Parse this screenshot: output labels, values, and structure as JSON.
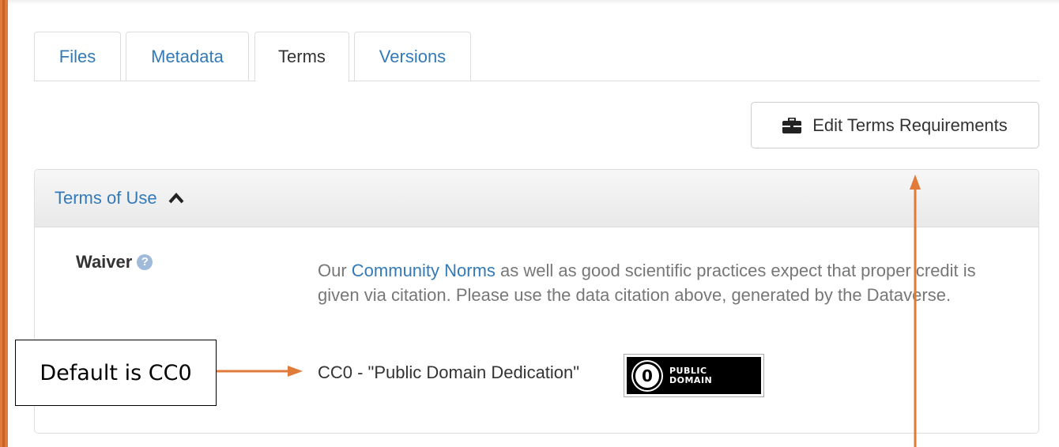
{
  "tabs": [
    {
      "label": "Files",
      "active": false
    },
    {
      "label": "Metadata",
      "active": false
    },
    {
      "label": "Terms",
      "active": true
    },
    {
      "label": "Versions",
      "active": false
    }
  ],
  "toolbar": {
    "edit_terms_label": "Edit Terms Requirements",
    "edit_terms_icon": "briefcase-icon"
  },
  "panel": {
    "heading": "Terms of Use",
    "heading_icon": "chevron-up-icon",
    "waiver_label": "Waiver",
    "help_icon_glyph": "?",
    "norms_prefix": "Our ",
    "norms_link": "Community Norms",
    "norms_suffix": " as well as good scientific practices expect that proper credit is given via citation. Please use the data citation above, generated by the Dataverse.",
    "license_text": "CC0 - \"Public Domain Dedication\"",
    "badge": {
      "symbol": "0",
      "line1": "PUBLIC",
      "line2": "DOMAIN"
    }
  },
  "annotation": {
    "callout_text": "Default is CC0",
    "arrow_color": "#e07b39"
  },
  "colors": {
    "link": "#337ab7",
    "accent": "#e07b39",
    "muted_text": "#777777"
  }
}
